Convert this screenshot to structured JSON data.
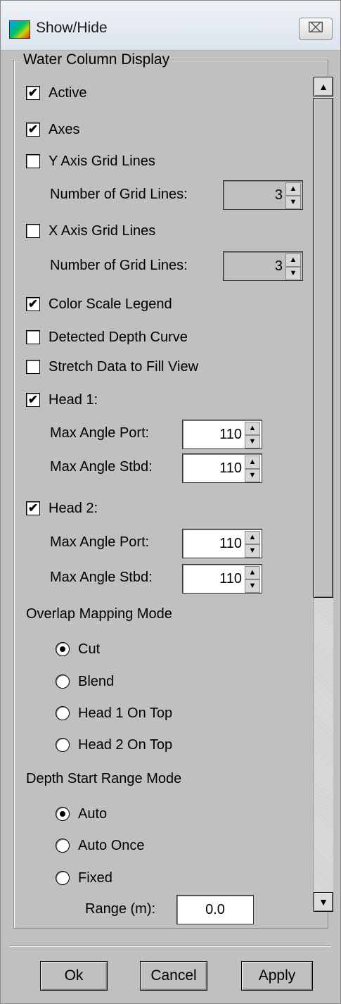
{
  "window": {
    "title": "Show/Hide",
    "close_glyph": "⌧"
  },
  "group": {
    "title": "Water Column Display"
  },
  "options": {
    "active": {
      "label": "Active",
      "checked": true
    },
    "axes": {
      "label": "Axes",
      "checked": true
    },
    "y_grid": {
      "label": "Y Axis Grid Lines",
      "checked": false,
      "count_label": "Number of Grid Lines:",
      "count": "3"
    },
    "x_grid": {
      "label": "X Axis Grid Lines",
      "checked": false,
      "count_label": "Number of Grid Lines:",
      "count": "3"
    },
    "color_scale": {
      "label": "Color Scale Legend",
      "checked": true
    },
    "depth_curve": {
      "label": "Detected Depth Curve",
      "checked": false
    },
    "stretch": {
      "label": "Stretch Data to Fill View",
      "checked": false
    },
    "head1": {
      "label": "Head 1:",
      "checked": true,
      "port_label": "Max Angle Port:",
      "port": "110",
      "stbd_label": "Max Angle Stbd:",
      "stbd": "110"
    },
    "head2": {
      "label": "Head 2:",
      "checked": true,
      "port_label": "Max Angle Port:",
      "port": "110",
      "stbd_label": "Max Angle Stbd:",
      "stbd": "110"
    }
  },
  "overlap": {
    "label": "Overlap Mapping Mode",
    "options": [
      {
        "label": "Cut",
        "selected": true
      },
      {
        "label": "Blend",
        "selected": false
      },
      {
        "label": "Head 1 On Top",
        "selected": false
      },
      {
        "label": "Head 2 On Top",
        "selected": false
      }
    ]
  },
  "depth_start": {
    "label": "Depth Start Range Mode",
    "options": [
      {
        "label": "Auto",
        "selected": true
      },
      {
        "label": "Auto Once",
        "selected": false
      },
      {
        "label": "Fixed",
        "selected": false
      }
    ],
    "range_label": "Range (m):",
    "range_value": "0.0"
  },
  "buttons": {
    "ok": "Ok",
    "cancel": "Cancel",
    "apply": "Apply"
  },
  "icons": {
    "check": "✔",
    "up": "▲",
    "down": "▼"
  }
}
